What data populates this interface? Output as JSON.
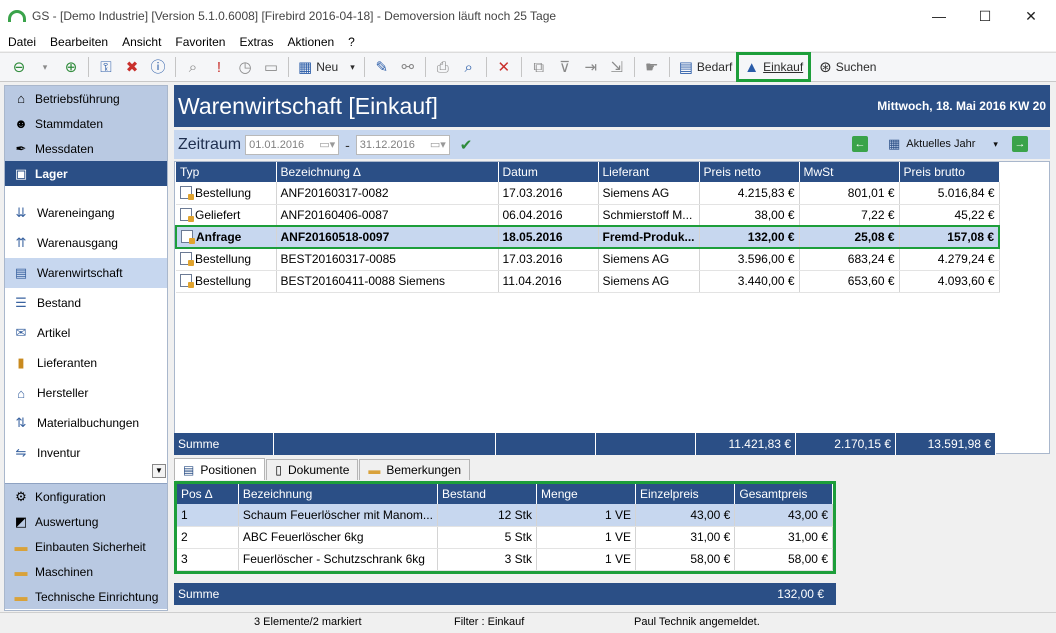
{
  "window": {
    "title": "GS - [Demo Industrie]  [Version  5.1.0.6008]  [Firebird 2016-04-18]  - Demoversion läuft noch 25 Tage",
    "controls": {
      "minimize": "—",
      "maximize": "☐",
      "close": "✕"
    }
  },
  "menu": [
    {
      "label": "Datei"
    },
    {
      "label": "Bearbeiten"
    },
    {
      "label": "Ansicht"
    },
    {
      "label": "Favoriten"
    },
    {
      "label": "Extras"
    },
    {
      "label": "Aktionen"
    },
    {
      "label": "?"
    }
  ],
  "toolbar": {
    "new_label": "Neu",
    "bedarf_label": "Bedarf",
    "einkauf_label": "Einkauf",
    "suchen_label": "Suchen"
  },
  "sidebar": {
    "top": [
      {
        "label": "Betriebsführung",
        "icon": "house-icon"
      },
      {
        "label": "Stammdaten",
        "icon": "people-icon"
      },
      {
        "label": "Messdaten",
        "icon": "pen-icon"
      },
      {
        "label": "Lager",
        "icon": "box-icon"
      }
    ],
    "sub": [
      {
        "label": "Wareneingang",
        "icon": "inbound-icon"
      },
      {
        "label": "Warenausgang",
        "icon": "outbound-icon"
      },
      {
        "label": "Warenwirtschaft",
        "icon": "stock-icon"
      },
      {
        "label": "Bestand",
        "icon": "list-icon"
      },
      {
        "label": "Artikel",
        "icon": "article-icon"
      },
      {
        "label": "Lieferanten",
        "icon": "supplier-icon"
      },
      {
        "label": "Hersteller",
        "icon": "factory-icon"
      },
      {
        "label": "Materialbuchungen",
        "icon": "booking-icon"
      },
      {
        "label": "Inventur",
        "icon": "inventory-icon"
      }
    ],
    "bottom": [
      {
        "label": "Konfiguration",
        "icon": "gear-icon"
      },
      {
        "label": "Auswertung",
        "icon": "chart-icon"
      },
      {
        "label": "Einbauten Sicherheit",
        "icon": "folder-icon"
      },
      {
        "label": "Maschinen",
        "icon": "folder-icon"
      },
      {
        "label": "Technische Einrichtung",
        "icon": "folder-icon"
      }
    ]
  },
  "header": {
    "title": "Warenwirtschaft [Einkauf]",
    "date": "Mittwoch, 18. Mai 2016  KW 20"
  },
  "filter": {
    "label": "Zeitraum",
    "from": "01.01.2016",
    "to": "31.12.2016",
    "separator": "-",
    "period": "Aktuelles Jahr"
  },
  "main_table": {
    "columns": [
      "Typ",
      "Bezeichnung",
      "Datum",
      "Lieferant",
      "Preis netto",
      "MwSt",
      "Preis brutto"
    ],
    "sort_indicator": "∆",
    "rows": [
      {
        "typ": "Bestellung",
        "bez": "ANF20160317-0082",
        "datum": "17.03.2016",
        "lieferant": "Siemens AG",
        "netto": "4.215,83 €",
        "mwst": "801,01 €",
        "brutto": "5.016,84 €"
      },
      {
        "typ": "Geliefert",
        "bez": "ANF20160406-0087",
        "datum": "06.04.2016",
        "lieferant": "Schmierstoff M...",
        "netto": "38,00 €",
        "mwst": "7,22 €",
        "brutto": "45,22 €"
      },
      {
        "typ": "Anfrage",
        "bez": "ANF20160518-0097",
        "datum": "18.05.2016",
        "lieferant": "Fremd-Produk...",
        "netto": "132,00 €",
        "mwst": "25,08 €",
        "brutto": "157,08 €"
      },
      {
        "typ": "Bestellung",
        "bez": "BEST20160317-0085",
        "datum": "17.03.2016",
        "lieferant": "Siemens AG",
        "netto": "3.596,00 €",
        "mwst": "683,24 €",
        "brutto": "4.279,24 €"
      },
      {
        "typ": "Bestellung",
        "bez": "BEST20160411-0088 Siemens",
        "datum": "11.04.2016",
        "lieferant": "Siemens AG",
        "netto": "3.440,00 €",
        "mwst": "653,60 €",
        "brutto": "4.093,60 €"
      }
    ],
    "summary": {
      "label": "Summe",
      "netto": "11.421,83 €",
      "mwst": "2.170,15 €",
      "brutto": "13.591,98 €"
    }
  },
  "tabs": [
    {
      "label": "Positionen",
      "active": true
    },
    {
      "label": "Dokumente",
      "active": false
    },
    {
      "label": "Bemerkungen",
      "active": false
    }
  ],
  "positions_table": {
    "columns": [
      "Pos",
      "Bezeichnung",
      "Bestand",
      "Menge",
      "Einzelpreis",
      "Gesamtpreis"
    ],
    "sort_indicator": "∆",
    "rows": [
      {
        "pos": "1",
        "bez": "Schaum Feuerlöscher mit Manom...",
        "bestand": "12 Stk",
        "menge": "1 VE",
        "einzel": "43,00 €",
        "gesamt": "43,00 €"
      },
      {
        "pos": "2",
        "bez": "ABC Feuerlöscher  6kg",
        "bestand": "5 Stk",
        "menge": "1 VE",
        "einzel": "31,00 €",
        "gesamt": "31,00 €"
      },
      {
        "pos": "3",
        "bez": "Feuerlöscher - Schutzschrank 6kg",
        "bestand": "3 Stk",
        "menge": "1 VE",
        "einzel": "58,00 €",
        "gesamt": "58,00 €"
      }
    ],
    "summary": {
      "label": "Summe",
      "total": "132,00 €"
    }
  },
  "status": {
    "count": "3 Elemente/2 markiert",
    "filter": "Filter : Einkauf",
    "user": "Paul Technik angemeldet."
  },
  "colors": {
    "accent": "#2b4f86",
    "highlight": "#1d9e3a",
    "selection": "#c7d7ef"
  }
}
